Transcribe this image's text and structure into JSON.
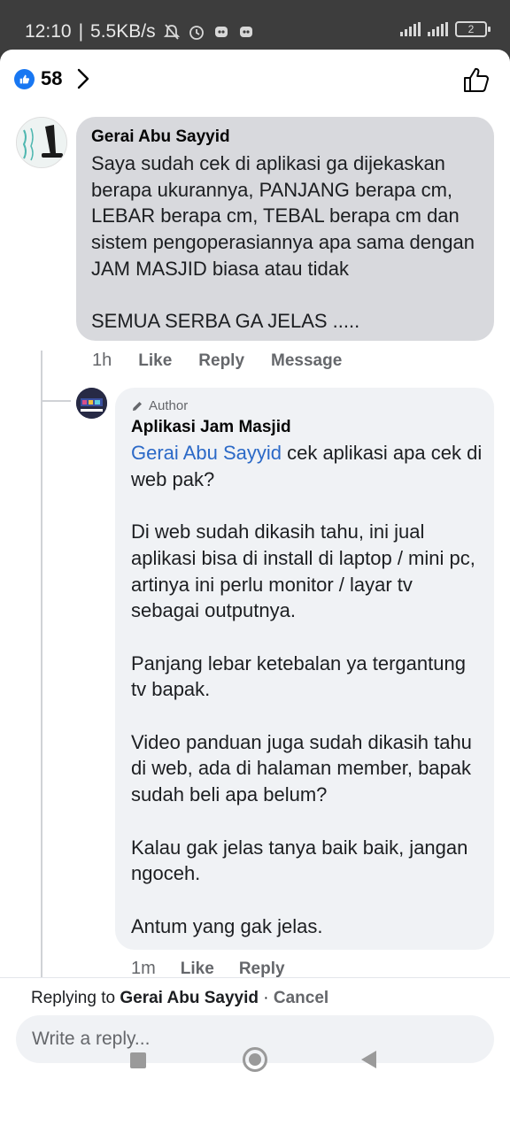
{
  "status_bar": {
    "time": "12:10",
    "net_speed": "5.5KB/s",
    "battery": "2"
  },
  "header": {
    "like_count": "58"
  },
  "comment": {
    "author": "Gerai Abu Sayyid",
    "text": "Saya sudah cek di aplikasi ga dijekaskan berapa ukurannya, PANJANG berapa cm, LEBAR berapa cm, TEBAL berapa cm dan sistem pengoperasiannya apa sama dengan JAM MASJID biasa atau tidak\n\nSEMUA SERBA GA JELAS .....",
    "time": "1h",
    "like_label": "Like",
    "reply_label": "Reply",
    "message_label": "Message"
  },
  "reply": {
    "badge": "Author",
    "author": "Aplikasi Jam Masjid",
    "mention": "Gerai Abu Sayyid",
    "text_after_mention": " cek aplikasi apa cek di web pak?\n\nDi web sudah dikasih tahu, ini jual aplikasi bisa di install di laptop / mini pc, artinya ini perlu monitor / layar tv sebagai outputnya.\n\nPanjang lebar ketebalan ya tergantung tv bapak.\n\nVideo panduan juga sudah dikasih tahu di web, ada di halaman member, bapak sudah beli apa belum?\n\nKalau gak jelas tanya baik baik, jangan ngoceh.\n\nAntum yang gak jelas.",
    "time": "1m",
    "like_label": "Like",
    "reply_label": "Reply"
  },
  "composer": {
    "replying_prefix": "Replying to ",
    "replying_name": "Gerai Abu Sayyid",
    "separator": " · ",
    "cancel_label": "Cancel",
    "placeholder": "Write a reply..."
  }
}
